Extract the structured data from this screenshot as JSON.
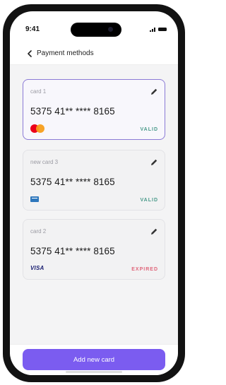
{
  "status_bar": {
    "time": "9:41"
  },
  "header": {
    "title": "Payment methods",
    "back_icon": "chevron-left-icon"
  },
  "cards": [
    {
      "name": "card 1",
      "number": "5375 41** **** 8165",
      "brand": "mastercard",
      "status": "VALID",
      "status_color": "#4a9a8a",
      "selected": true
    },
    {
      "name": "new card 3",
      "number": "5375 41** **** 8165",
      "brand": "amex",
      "status": "VALID",
      "status_color": "#4a9a8a",
      "selected": false
    },
    {
      "name": "card 2",
      "number": "5375 41** **** 8165",
      "brand": "visa",
      "brand_text": "VISA",
      "status": "EXPIRED",
      "status_color": "#e0667a",
      "selected": false
    }
  ],
  "add_button": {
    "label": "Add new card",
    "color": "#7b5cf0"
  },
  "colors": {
    "accent": "#7b5cf0",
    "selected_border": "#8b7ad6",
    "valid": "#4a9a8a",
    "expired": "#e0667a"
  }
}
